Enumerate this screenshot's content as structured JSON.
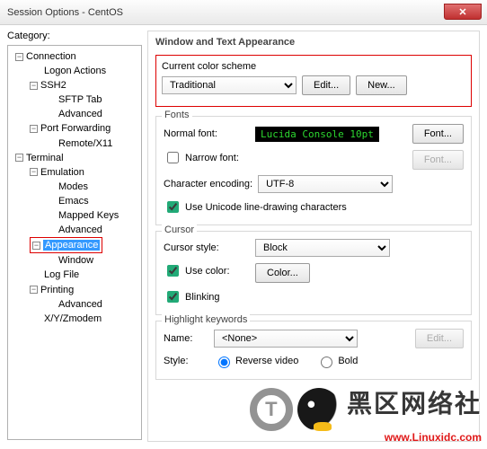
{
  "window": {
    "title": "Session Options - CentOS"
  },
  "category_label": "Category:",
  "tree": {
    "connection": "Connection",
    "logon_actions": "Logon Actions",
    "ssh2": "SSH2",
    "sftp_tab": "SFTP Tab",
    "advanced": "Advanced",
    "port_forwarding": "Port Forwarding",
    "remote_x11": "Remote/X11",
    "terminal": "Terminal",
    "emulation": "Emulation",
    "modes": "Modes",
    "emacs": "Emacs",
    "mapped_keys": "Mapped Keys",
    "emu_advanced": "Advanced",
    "appearance": "Appearance",
    "window": "Window",
    "log_file": "Log File",
    "printing": "Printing",
    "print_advanced": "Advanced",
    "xyzmodem": "X/Y/Zmodem"
  },
  "panel": {
    "title": "Window and Text Appearance",
    "scheme": {
      "legend": "Current color scheme",
      "value": "Traditional",
      "edit": "Edit...",
      "new": "New..."
    },
    "fonts": {
      "legend": "Fonts",
      "normal_label": "Normal font:",
      "normal_value": "Lucida Console 10pt",
      "font_btn": "Font...",
      "narrow_label": "Narrow font:",
      "encoding_label": "Character encoding:",
      "encoding_value": "UTF-8",
      "unicode_label": "Use Unicode line-drawing characters"
    },
    "cursor": {
      "legend": "Cursor",
      "style_label": "Cursor style:",
      "style_value": "Block",
      "use_color_label": "Use color:",
      "color_btn": "Color...",
      "blinking_label": "Blinking"
    },
    "highlight": {
      "legend": "Highlight keywords",
      "name_label": "Name:",
      "name_value": "<None>",
      "edit": "Edit...",
      "style_label": "Style:",
      "reverse": "Reverse video",
      "bold": "Bold"
    }
  },
  "watermark": {
    "text": "黑区网络社",
    "url": "www.Linuxidc.com"
  }
}
